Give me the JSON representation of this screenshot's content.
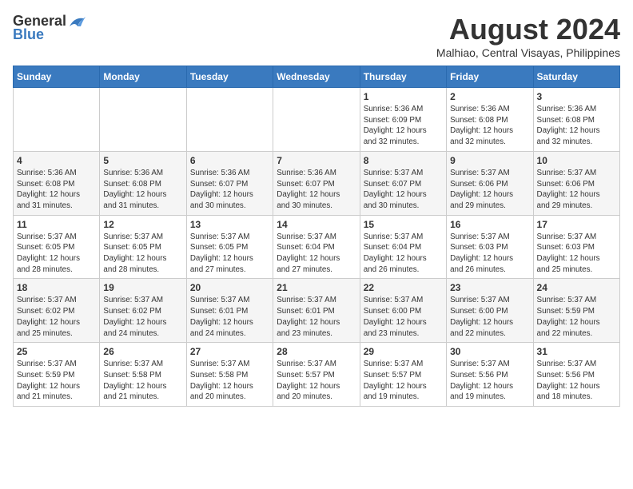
{
  "header": {
    "logo_general": "General",
    "logo_blue": "Blue",
    "month_year": "August 2024",
    "location": "Malhiao, Central Visayas, Philippines"
  },
  "weekdays": [
    "Sunday",
    "Monday",
    "Tuesday",
    "Wednesday",
    "Thursday",
    "Friday",
    "Saturday"
  ],
  "weeks": [
    [
      {
        "day": "",
        "info": ""
      },
      {
        "day": "",
        "info": ""
      },
      {
        "day": "",
        "info": ""
      },
      {
        "day": "",
        "info": ""
      },
      {
        "day": "1",
        "info": "Sunrise: 5:36 AM\nSunset: 6:09 PM\nDaylight: 12 hours\nand 32 minutes."
      },
      {
        "day": "2",
        "info": "Sunrise: 5:36 AM\nSunset: 6:08 PM\nDaylight: 12 hours\nand 32 minutes."
      },
      {
        "day": "3",
        "info": "Sunrise: 5:36 AM\nSunset: 6:08 PM\nDaylight: 12 hours\nand 32 minutes."
      }
    ],
    [
      {
        "day": "4",
        "info": "Sunrise: 5:36 AM\nSunset: 6:08 PM\nDaylight: 12 hours\nand 31 minutes."
      },
      {
        "day": "5",
        "info": "Sunrise: 5:36 AM\nSunset: 6:08 PM\nDaylight: 12 hours\nand 31 minutes."
      },
      {
        "day": "6",
        "info": "Sunrise: 5:36 AM\nSunset: 6:07 PM\nDaylight: 12 hours\nand 30 minutes."
      },
      {
        "day": "7",
        "info": "Sunrise: 5:36 AM\nSunset: 6:07 PM\nDaylight: 12 hours\nand 30 minutes."
      },
      {
        "day": "8",
        "info": "Sunrise: 5:37 AM\nSunset: 6:07 PM\nDaylight: 12 hours\nand 30 minutes."
      },
      {
        "day": "9",
        "info": "Sunrise: 5:37 AM\nSunset: 6:06 PM\nDaylight: 12 hours\nand 29 minutes."
      },
      {
        "day": "10",
        "info": "Sunrise: 5:37 AM\nSunset: 6:06 PM\nDaylight: 12 hours\nand 29 minutes."
      }
    ],
    [
      {
        "day": "11",
        "info": "Sunrise: 5:37 AM\nSunset: 6:05 PM\nDaylight: 12 hours\nand 28 minutes."
      },
      {
        "day": "12",
        "info": "Sunrise: 5:37 AM\nSunset: 6:05 PM\nDaylight: 12 hours\nand 28 minutes."
      },
      {
        "day": "13",
        "info": "Sunrise: 5:37 AM\nSunset: 6:05 PM\nDaylight: 12 hours\nand 27 minutes."
      },
      {
        "day": "14",
        "info": "Sunrise: 5:37 AM\nSunset: 6:04 PM\nDaylight: 12 hours\nand 27 minutes."
      },
      {
        "day": "15",
        "info": "Sunrise: 5:37 AM\nSunset: 6:04 PM\nDaylight: 12 hours\nand 26 minutes."
      },
      {
        "day": "16",
        "info": "Sunrise: 5:37 AM\nSunset: 6:03 PM\nDaylight: 12 hours\nand 26 minutes."
      },
      {
        "day": "17",
        "info": "Sunrise: 5:37 AM\nSunset: 6:03 PM\nDaylight: 12 hours\nand 25 minutes."
      }
    ],
    [
      {
        "day": "18",
        "info": "Sunrise: 5:37 AM\nSunset: 6:02 PM\nDaylight: 12 hours\nand 25 minutes."
      },
      {
        "day": "19",
        "info": "Sunrise: 5:37 AM\nSunset: 6:02 PM\nDaylight: 12 hours\nand 24 minutes."
      },
      {
        "day": "20",
        "info": "Sunrise: 5:37 AM\nSunset: 6:01 PM\nDaylight: 12 hours\nand 24 minutes."
      },
      {
        "day": "21",
        "info": "Sunrise: 5:37 AM\nSunset: 6:01 PM\nDaylight: 12 hours\nand 23 minutes."
      },
      {
        "day": "22",
        "info": "Sunrise: 5:37 AM\nSunset: 6:00 PM\nDaylight: 12 hours\nand 23 minutes."
      },
      {
        "day": "23",
        "info": "Sunrise: 5:37 AM\nSunset: 6:00 PM\nDaylight: 12 hours\nand 22 minutes."
      },
      {
        "day": "24",
        "info": "Sunrise: 5:37 AM\nSunset: 5:59 PM\nDaylight: 12 hours\nand 22 minutes."
      }
    ],
    [
      {
        "day": "25",
        "info": "Sunrise: 5:37 AM\nSunset: 5:59 PM\nDaylight: 12 hours\nand 21 minutes."
      },
      {
        "day": "26",
        "info": "Sunrise: 5:37 AM\nSunset: 5:58 PM\nDaylight: 12 hours\nand 21 minutes."
      },
      {
        "day": "27",
        "info": "Sunrise: 5:37 AM\nSunset: 5:58 PM\nDaylight: 12 hours\nand 20 minutes."
      },
      {
        "day": "28",
        "info": "Sunrise: 5:37 AM\nSunset: 5:57 PM\nDaylight: 12 hours\nand 20 minutes."
      },
      {
        "day": "29",
        "info": "Sunrise: 5:37 AM\nSunset: 5:57 PM\nDaylight: 12 hours\nand 19 minutes."
      },
      {
        "day": "30",
        "info": "Sunrise: 5:37 AM\nSunset: 5:56 PM\nDaylight: 12 hours\nand 19 minutes."
      },
      {
        "day": "31",
        "info": "Sunrise: 5:37 AM\nSunset: 5:56 PM\nDaylight: 12 hours\nand 18 minutes."
      }
    ]
  ]
}
